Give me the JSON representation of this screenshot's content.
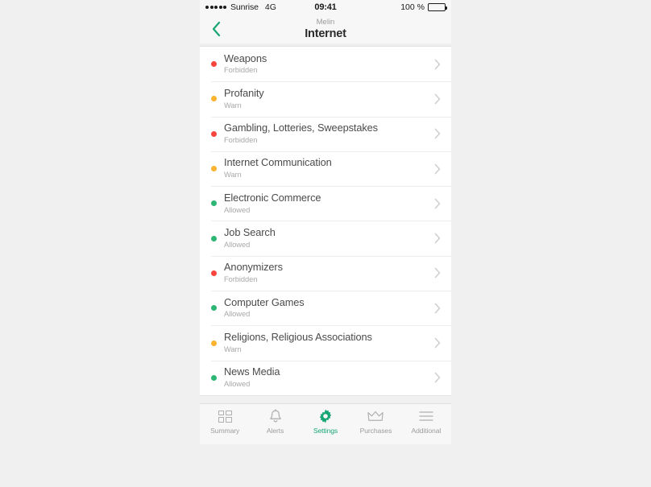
{
  "status_bar": {
    "signal_dots": 5,
    "carrier": "Sunrise",
    "network": "4G",
    "time": "09:41",
    "battery_text": "100 %",
    "battery_level_pct": 100
  },
  "nav": {
    "back_icon": "chevron-left-icon",
    "subtitle": "Melin",
    "title": "Internet"
  },
  "colors": {
    "accent": "#17a673",
    "forbidden": "#f9443d",
    "warn": "#fbb22e",
    "allowed": "#2db573",
    "page_background": "#f0f0f0",
    "card_background": "#ffffff"
  },
  "list": {
    "items": [
      {
        "title": "Weapons",
        "status": "Forbidden",
        "dot": "#f9443d"
      },
      {
        "title": "Profanity",
        "status": "Warn",
        "dot": "#fbb22e"
      },
      {
        "title": "Gambling, Lotteries, Sweepstakes",
        "status": "Forbidden",
        "dot": "#f9443d"
      },
      {
        "title": "Internet Communication",
        "status": "Warn",
        "dot": "#fbb22e"
      },
      {
        "title": "Electronic Commerce",
        "status": "Allowed",
        "dot": "#2db573"
      },
      {
        "title": "Job Search",
        "status": "Allowed",
        "dot": "#2db573"
      },
      {
        "title": "Anonymizers",
        "status": "Forbidden",
        "dot": "#f9443d"
      },
      {
        "title": "Computer Games",
        "status": "Allowed",
        "dot": "#2db573"
      },
      {
        "title": "Religions, Religious Associations",
        "status": "Warn",
        "dot": "#fbb22e"
      },
      {
        "title": "News Media",
        "status": "Allowed",
        "dot": "#2db573"
      }
    ]
  },
  "tabbar": {
    "items": [
      {
        "label": "Summary",
        "icon": "grid-icon",
        "active": false
      },
      {
        "label": "Alerts",
        "icon": "bell-icon",
        "active": false
      },
      {
        "label": "Settings",
        "icon": "gear-icon",
        "active": true
      },
      {
        "label": "Purchases",
        "icon": "crown-icon",
        "active": false
      },
      {
        "label": "Additional",
        "icon": "hamburger-icon",
        "active": false
      }
    ]
  }
}
